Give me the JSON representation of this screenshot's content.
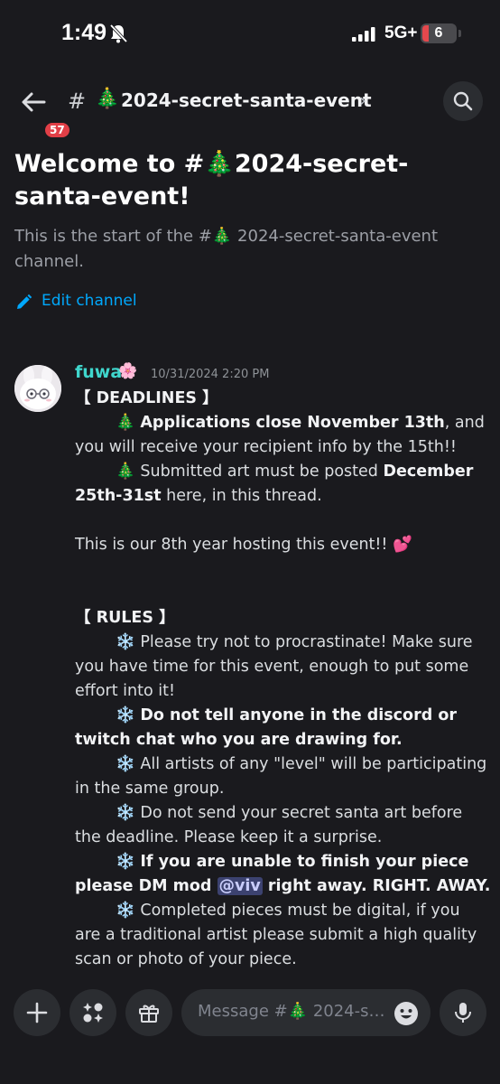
{
  "status_bar": {
    "time": "1:49",
    "network": "5G+",
    "battery": "6"
  },
  "header": {
    "back_badge": "57",
    "hash": "#",
    "tree_emoji": "🎄",
    "channel_name": "2024-secret-santa-event",
    "chevron": "›"
  },
  "welcome": {
    "title": "Welcome to #🎄2024-secret-santa-event!",
    "subtitle": "This is the start of the #🎄 2024-secret-santa-event channel.",
    "edit_label": "Edit channel"
  },
  "message": {
    "author": "fuwa",
    "author_emoji": "🌸",
    "timestamp": "10/31/2024 2:20 PM",
    "deadlines_header": "【 DEADLINES 】",
    "tree": "🎄",
    "snow": "❄️",
    "d1_bold": "Applications close November 13th",
    "d1_rest": ", and",
    "d1_line2": "you will receive your recipient info by the 15th!!",
    "d2_text": "Submitted art must be posted ",
    "d2_bold": "December",
    "d2_bold2": "25th-31st",
    "d2_rest": " here, in this thread.",
    "year_note": "This is our 8th year hosting this event!! 💕",
    "rules_header": "【 RULES 】",
    "r1_l1": "Please try not to procrastinate! Make sure",
    "r1_l2": "you have time for this event, enough to put some",
    "r1_l3": "effort into it!",
    "r2_l1": "Do not tell anyone in the discord or",
    "r2_l2": "twitch chat who you are drawing for.",
    "r3_l1": "All artists of any \"level\" will be participating",
    "r3_l2": "in the same group.",
    "r4_l1": "Do not send your secret santa art before",
    "r4_l2": "the deadline. Please keep it a surprise.",
    "r5_l1": "If you are unable to finish your piece",
    "r5_l2a": "please DM mod ",
    "r5_mention": "@viv",
    "r5_l2b": " right away. RIGHT. AWAY.",
    "r6_l1": "Completed pieces must be digital, if you",
    "r6_l2": "are a traditional artist please submit a high quality",
    "r6_l3": "scan or photo of your piece."
  },
  "composer": {
    "placeholder": "Message #🎄 2024-se..."
  },
  "colors": {
    "background": "#1a1a1e",
    "author": "#3fd6cc",
    "link": "#00a8fc",
    "badge": "#e13f47",
    "mention_bg": "#3c4270"
  }
}
